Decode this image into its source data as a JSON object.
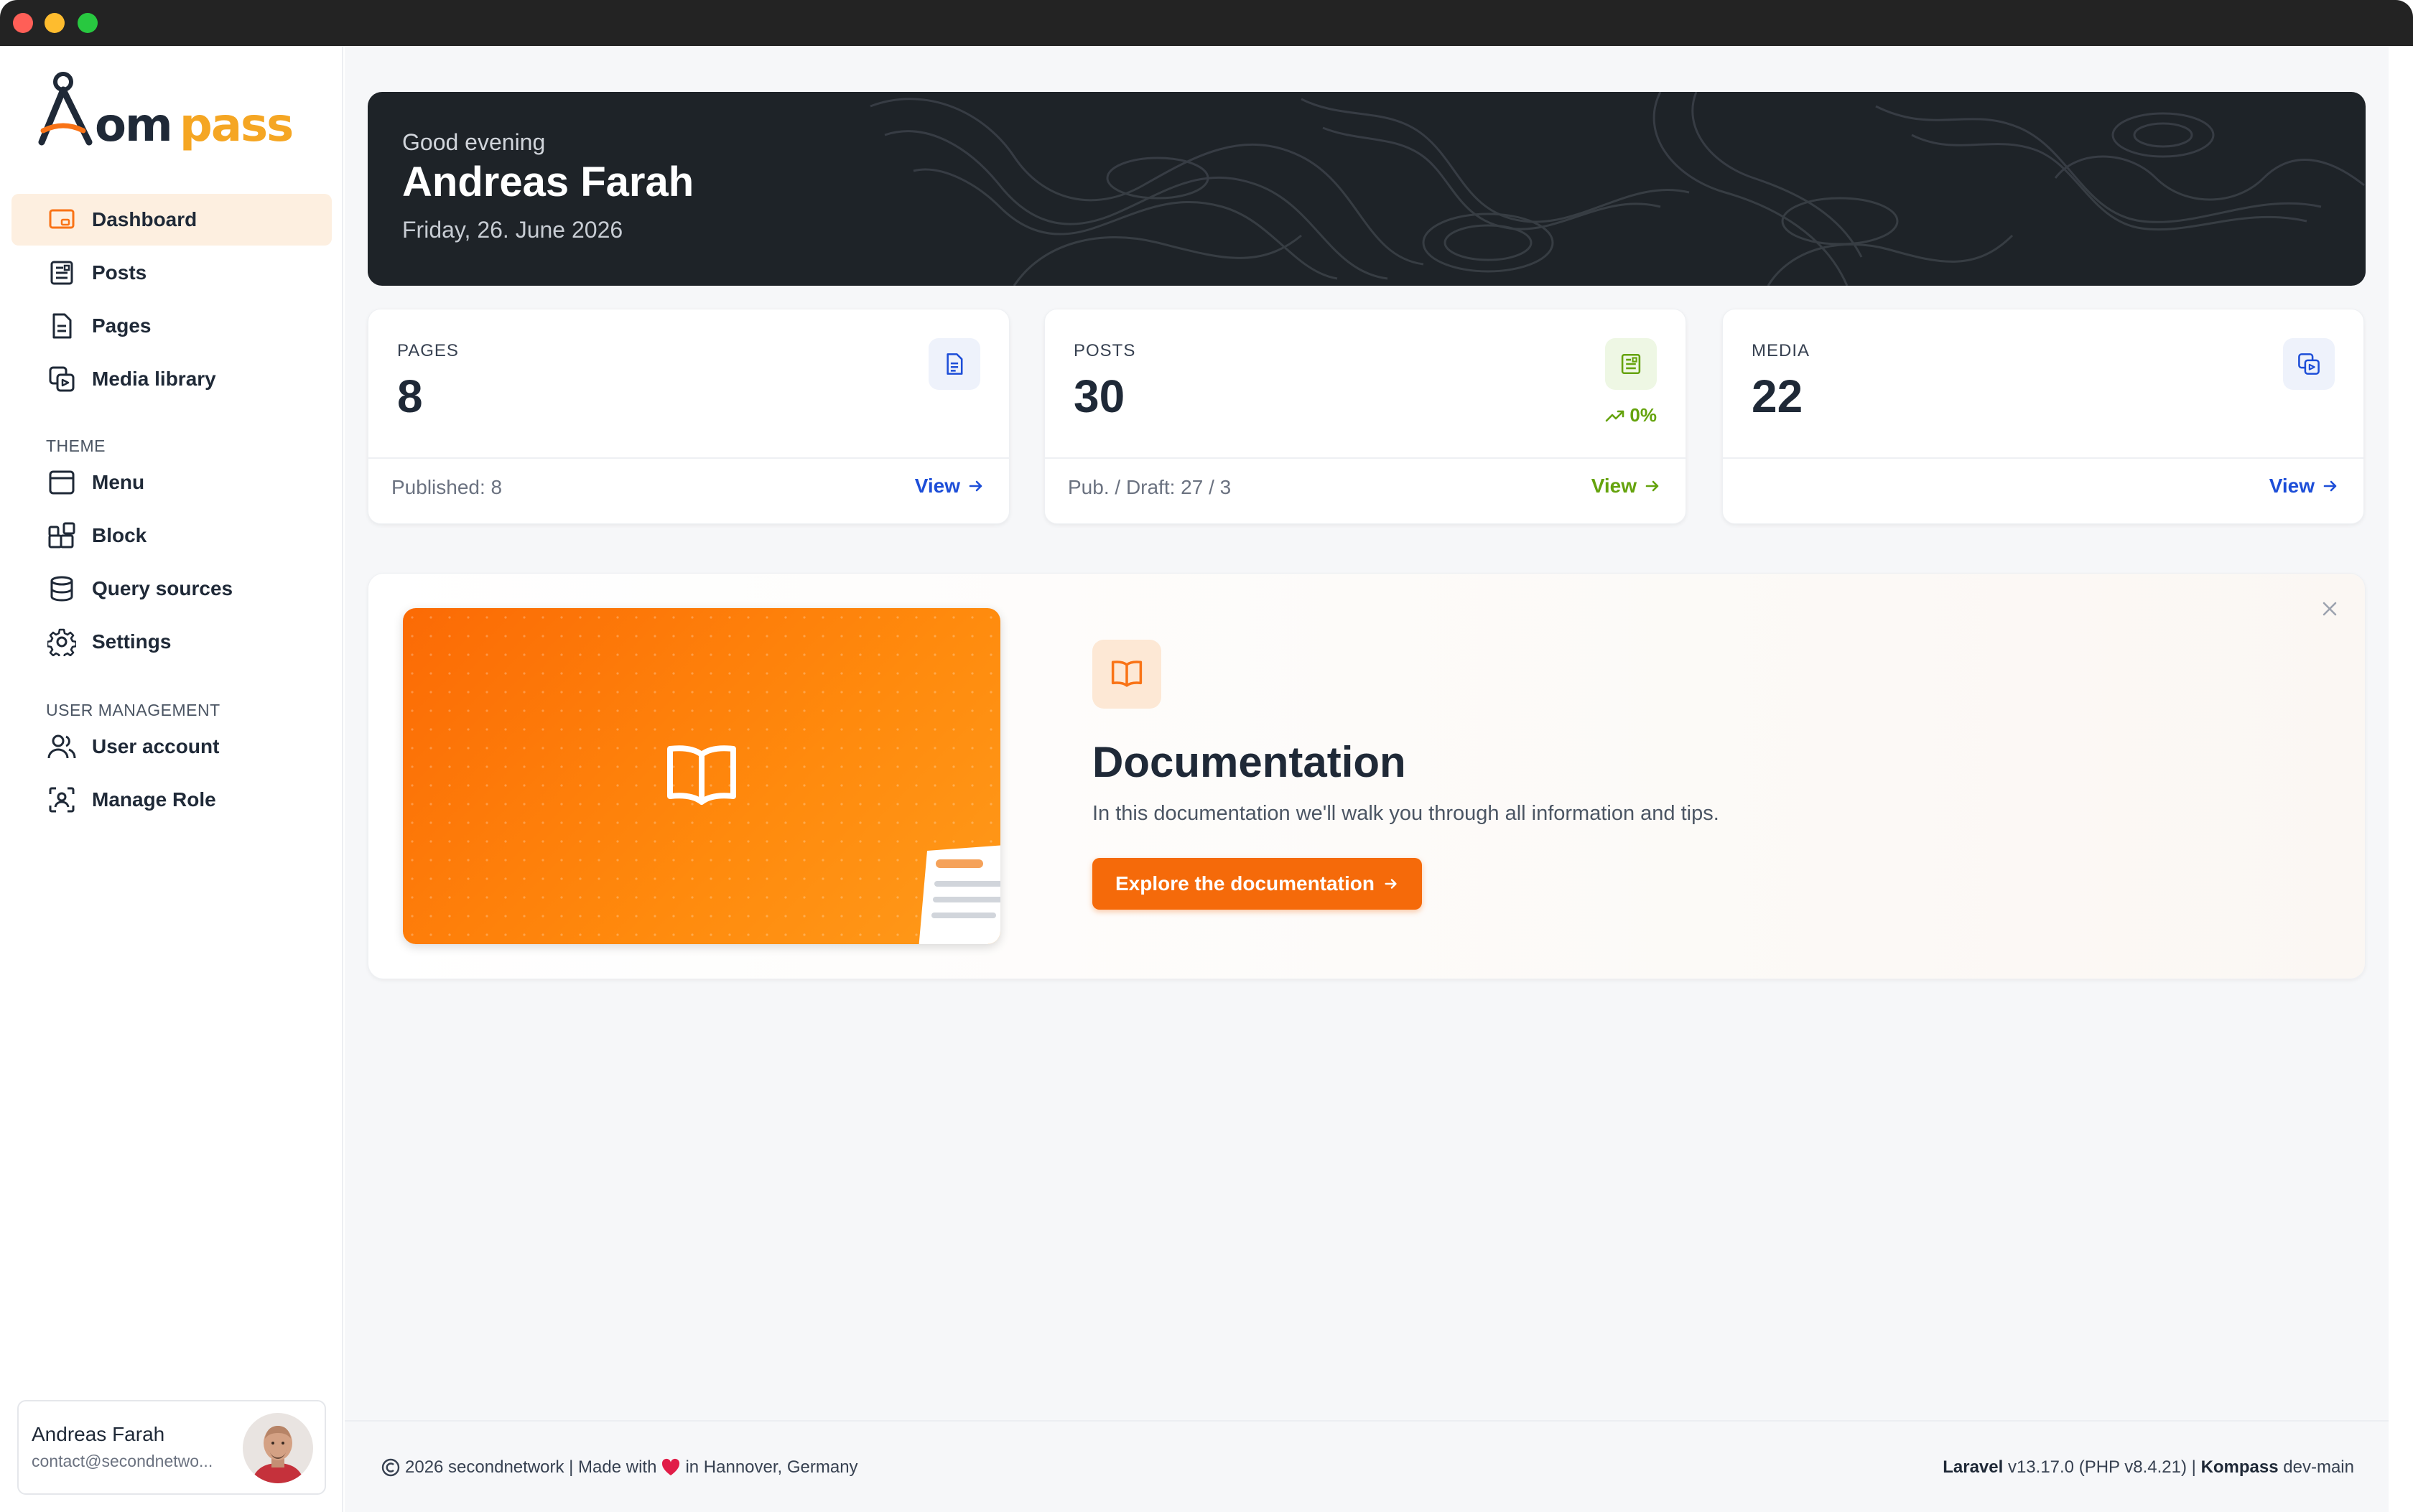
{
  "window": {
    "controls": [
      "close",
      "minimize",
      "maximize"
    ]
  },
  "brand": {
    "logo_text": "Kompass",
    "accent": "#f97316"
  },
  "sidebar": {
    "items": [
      {
        "label": "Dashboard",
        "icon": "dashboard-icon",
        "active": true
      },
      {
        "label": "Posts",
        "icon": "posts-icon"
      },
      {
        "label": "Pages",
        "icon": "page-icon"
      },
      {
        "label": "Media library",
        "icon": "media-icon"
      }
    ],
    "sections": [
      {
        "title": "THEME",
        "items": [
          {
            "label": "Menu",
            "icon": "menu-icon"
          },
          {
            "label": "Block",
            "icon": "block-icon"
          },
          {
            "label": "Query sources",
            "icon": "database-icon"
          },
          {
            "label": "Settings",
            "icon": "gear-icon"
          }
        ]
      },
      {
        "title": "USER MANAGEMENT",
        "items": [
          {
            "label": "User account",
            "icon": "users-icon"
          },
          {
            "label": "Manage Role",
            "icon": "role-icon"
          }
        ]
      }
    ],
    "user": {
      "name": "Andreas Farah",
      "email": "contact@secondnetwo..."
    }
  },
  "hero": {
    "greeting": "Good evening",
    "name": "Andreas Farah",
    "date": "Friday, 26. June 2026"
  },
  "stats": [
    {
      "label": "PAGES",
      "value": "8",
      "footer": "Published: 8",
      "link": "View",
      "color": "#1d4ed8",
      "badge_bg": "#eef2fb"
    },
    {
      "label": "POSTS",
      "value": "30",
      "footer": "Pub. / Draft: 27 / 3",
      "link": "View",
      "trend": "0%",
      "color": "#65a30d",
      "badge_bg": "#eef7e4"
    },
    {
      "label": "MEDIA",
      "value": "22",
      "footer": "",
      "link": "View",
      "color": "#1d4ed8",
      "badge_bg": "#eef2fb"
    }
  ],
  "documentation": {
    "title": "Documentation",
    "description": "In this documentation we'll walk you through all information and tips.",
    "button": "Explore the documentation"
  },
  "footer": {
    "left_text": "2026 secondnetwork | Made with",
    "left_suffix": "in Hannover, Germany",
    "framework": "Laravel",
    "framework_version": "v13.17.0 (PHP v8.4.21) |",
    "app": "Kompass",
    "app_version": "dev-main"
  }
}
